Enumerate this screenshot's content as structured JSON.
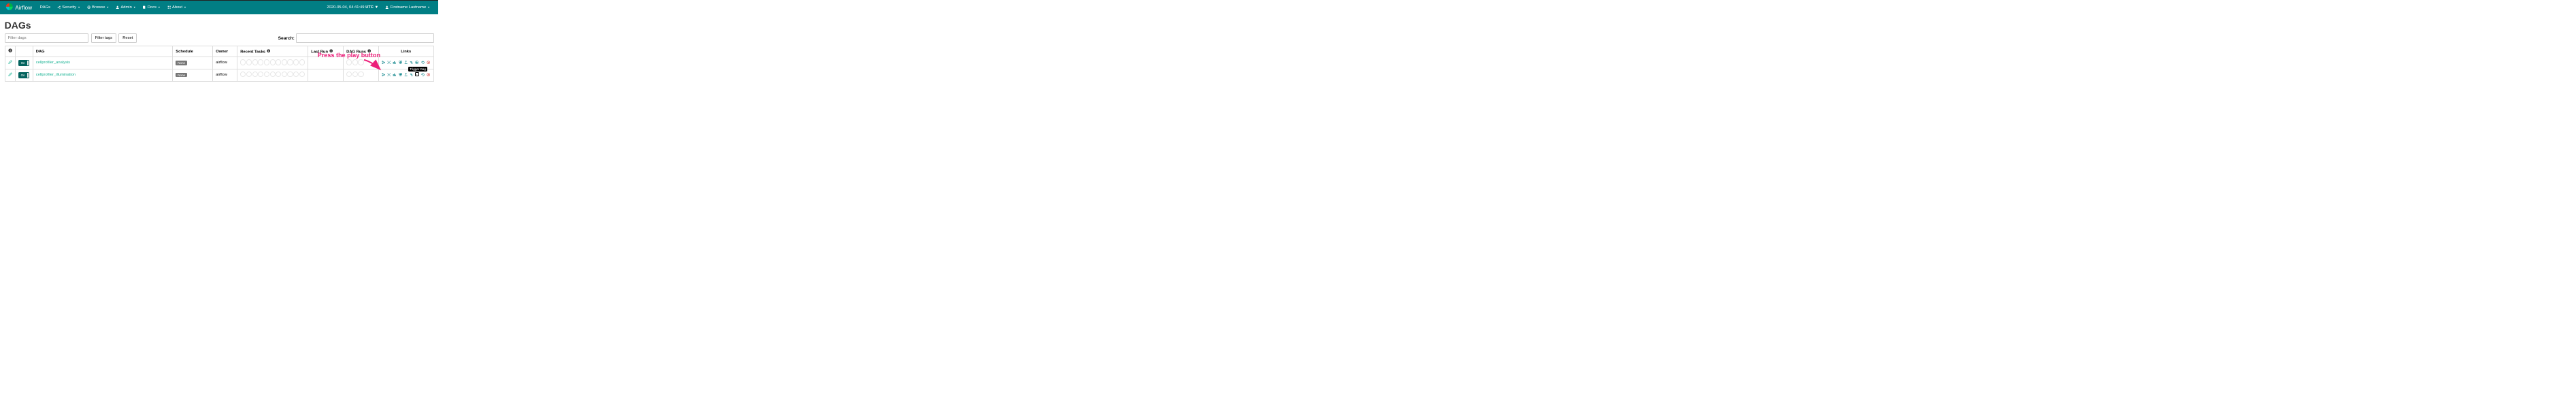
{
  "brand": "Airflow",
  "nav": {
    "dags": "DAGs",
    "security": "Security",
    "browse": "Browse",
    "admin": "Admin",
    "docs": "Docs",
    "about": "About"
  },
  "header": {
    "datetime_before": "2020-05-04, 04:41:49 ",
    "datetime_tz": "UTC",
    "user": "Firstname Lastname"
  },
  "page": {
    "title": "DAGs",
    "filter_placeholder": "Filter dags",
    "filter_tags_btn": "Filter tags",
    "reset_btn": "Reset",
    "search_label": "Search:"
  },
  "columns": {
    "dag": "DAG",
    "schedule": "Schedule",
    "owner": "Owner",
    "recent_tasks": "Recent Tasks",
    "last_run": "Last Run",
    "dag_runs": "DAG Runs",
    "links": "Links"
  },
  "rows": [
    {
      "toggle": "On",
      "dag_id": "cellprofiler_analysis",
      "schedule": "None",
      "owner": "airflow"
    },
    {
      "toggle": "On",
      "dag_id": "cellprofiler_illumination",
      "schedule": "None",
      "owner": "airflow"
    }
  ],
  "annotation": {
    "text": "Press the play button",
    "tooltip": "Trigger Dag"
  }
}
